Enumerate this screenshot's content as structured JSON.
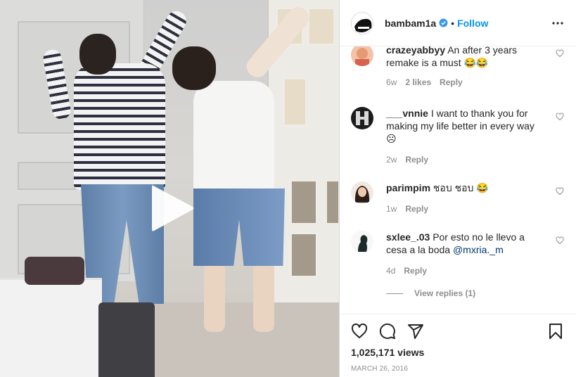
{
  "post": {
    "username": "bambam1a",
    "dot": "•",
    "follow_label": "Follow",
    "views": "1,025,171 views",
    "date": "MARCH 26, 2016"
  },
  "comments": [
    {
      "user": "crazeyabbyy",
      "text": "An after 3 years remake is a must",
      "emoji": "😂😂",
      "age": "6w",
      "likes": "2 likes",
      "reply": "Reply"
    },
    {
      "user": "___vnnie",
      "text": "I want to thank you for making my life better in every way",
      "emoji": "☹",
      "age": "2w",
      "reply": "Reply"
    },
    {
      "user": "parimpim",
      "text": "ชอบ ชอบ",
      "emoji": "😂",
      "age": "1w",
      "reply": "Reply"
    },
    {
      "user": "sxlee_.03",
      "text": "Por esto no le llevo a cesa a la boda",
      "mention": "@mxria._m",
      "age": "4d",
      "reply": "Reply"
    }
  ],
  "view_replies": "View replies (1)",
  "icons": {
    "verified": "verified-badge-icon",
    "more": "more-options-icon",
    "like": "heart-icon",
    "comment": "comment-bubble-icon",
    "share": "paper-plane-icon",
    "save": "bookmark-icon",
    "play": "play-icon"
  },
  "colors": {
    "accent": "#0095f6",
    "text": "#262626",
    "muted": "#8e8e8e",
    "mention": "#00376b"
  }
}
